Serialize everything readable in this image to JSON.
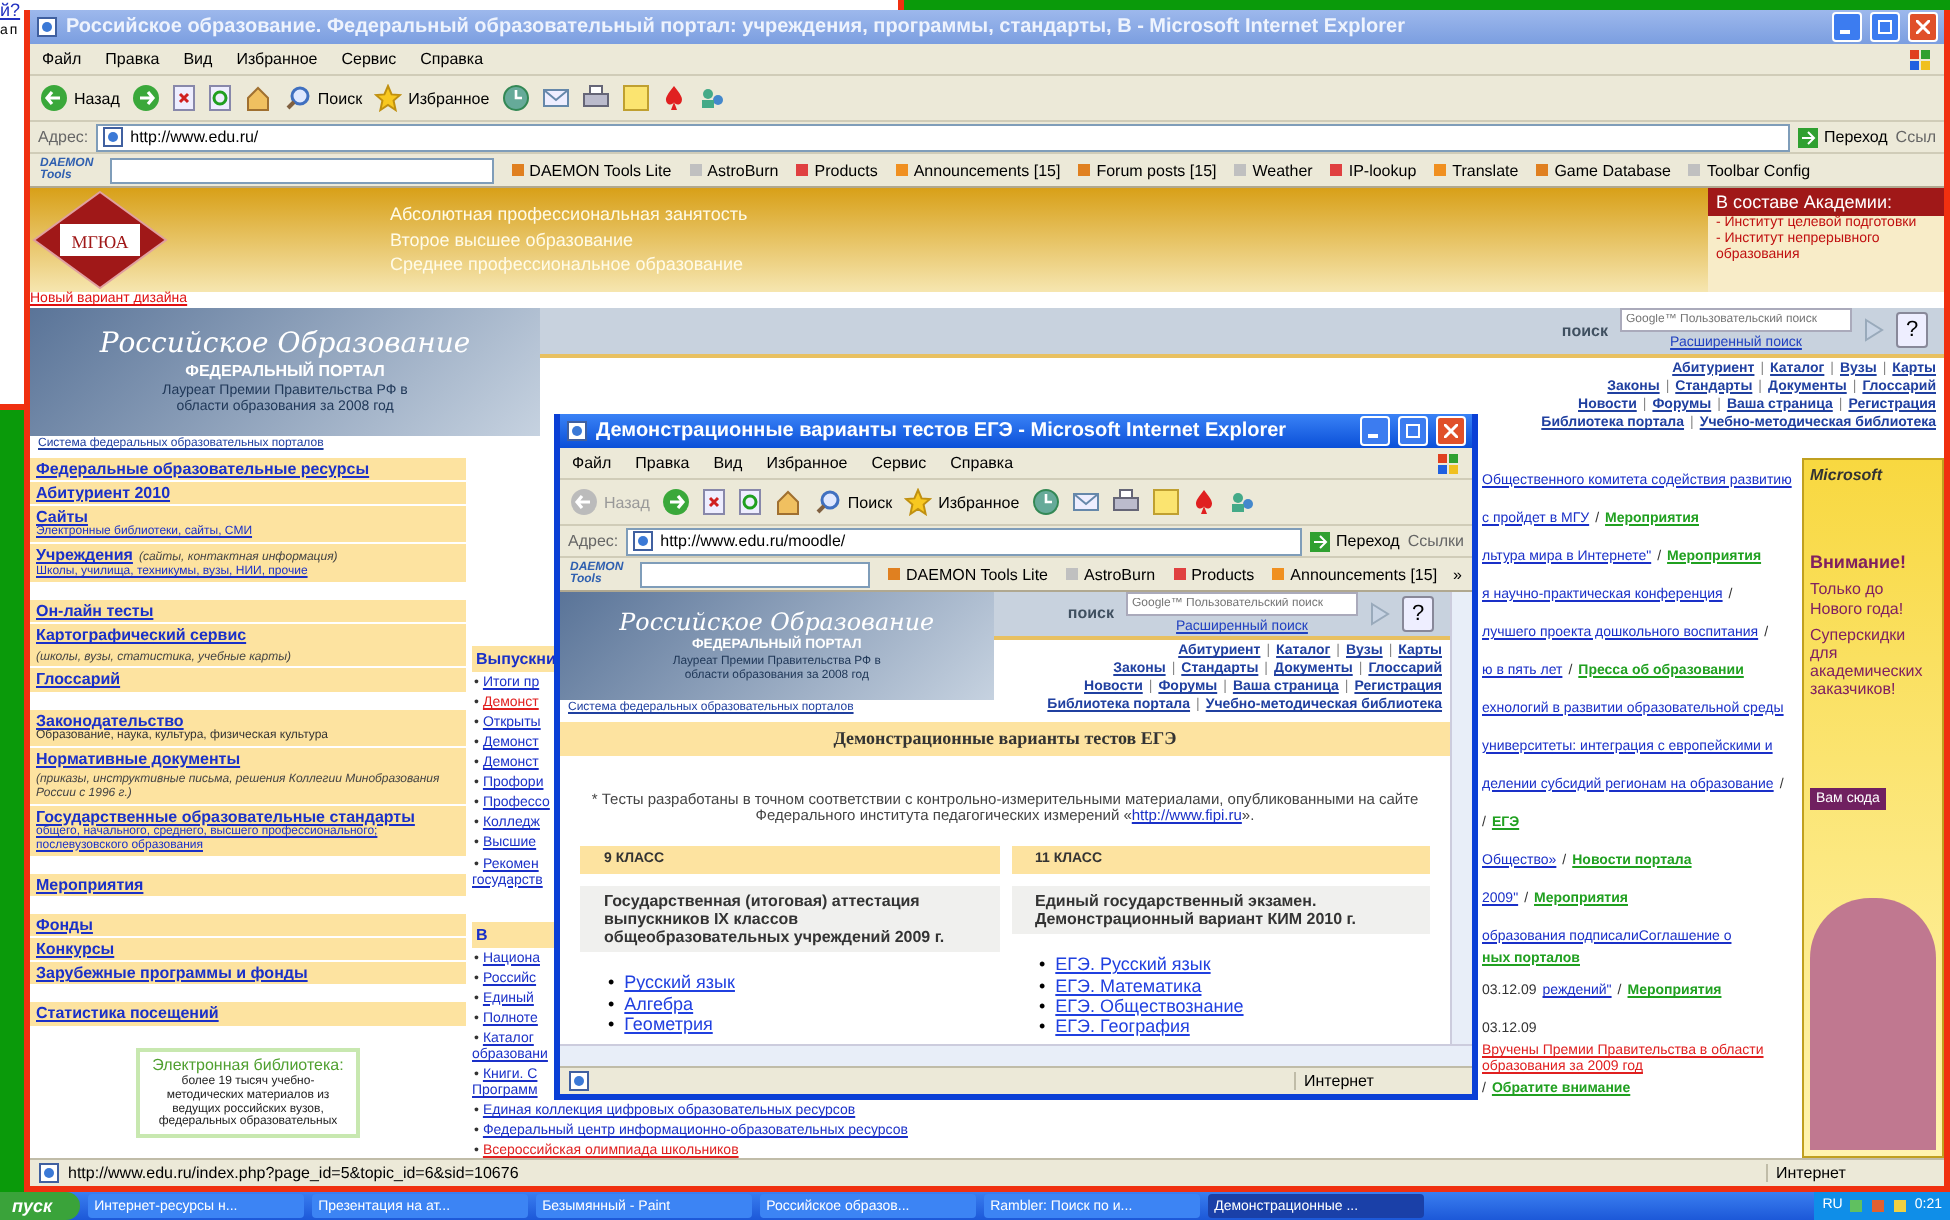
{
  "behind_window": {
    "link": "й?",
    "text": "а п"
  },
  "main_window": {
    "title": "Российское образование. Федеральный образовательный портал: учреждения, программы, стандарты, В - Microsoft Internet Explorer",
    "menu": [
      "Файл",
      "Правка",
      "Вид",
      "Избранное",
      "Сервис",
      "Справка"
    ],
    "toolbar": {
      "back": "Назад",
      "back_disabled": false,
      "search": "Поиск",
      "favorites": "Избранное"
    },
    "address": {
      "label": "Адрес:",
      "value": "http://www.edu.ru/",
      "go": "Переход",
      "links": "Ссыл"
    },
    "daemon": {
      "logo_top": "DAEMON",
      "logo_bottom": "Tools",
      "items": [
        "DAEMON Tools Lite",
        "AstroBurn",
        "Products",
        "Announcements [15]",
        "Forum posts [15]",
        "Weather",
        "IP-lookup",
        "Translate",
        "Game Database",
        "Toolbar Config"
      ]
    },
    "banner": {
      "logo": "МГЮА",
      "lines": [
        "Абсолютная профессиональная занятость",
        "Второе высшее образование",
        "Среднее профессиональное образование"
      ],
      "academy_title": "В составе Академии:",
      "academy_items": [
        "- Институт целевой подготовки",
        "- Институт непрерывного",
        "образования"
      ]
    },
    "new_design": "Новый вариант дизайна",
    "portal": {
      "logo": "Российское Образование",
      "subtitle": "ФЕДЕРАЛЬНЫЙ ПОРТАЛ",
      "laureate": "Лауреат Премии Правительства РФ в области образования за 2008 год",
      "search_label": "поиск",
      "search_placeholder": "Google™ Пользовательский поиск",
      "advanced": "Расширенный поиск",
      "help": "?",
      "nav": [
        [
          {
            "label": "Абитуриент"
          },
          {
            "sep": "|",
            "label": "Каталог"
          },
          {
            "sep": "|",
            "label": "Вузы"
          },
          {
            "sep": "|",
            "label": "Карты"
          }
        ],
        [
          {
            "label": "Законы"
          },
          {
            "sep": "|",
            "label": "Стандарты"
          },
          {
            "sep": "|",
            "label": "Документы"
          },
          {
            "sep": "|",
            "label": "Глоссарий"
          }
        ],
        [
          {
            "label": "Новости"
          },
          {
            "sep": "|",
            "label": "Форумы"
          },
          {
            "sep": "|",
            "label": "Ваша страница"
          },
          {
            "sep": "|",
            "label": "Регистрация"
          }
        ],
        [
          {
            "label": "Библиотека портала"
          },
          {
            "sep": "|",
            "label": "Учебно-методическая библиотека"
          }
        ]
      ],
      "system_link": "Система федеральных образовательных порталов"
    },
    "left_menu": [
      [
        {
          "title": "Федеральные образовательные ресурсы"
        },
        {
          "title": "Абитуриент 2010"
        },
        {
          "title": "Сайты",
          "sub": "Электронные библиотеки, сайты, СМИ"
        },
        {
          "title": "Учреждения",
          "note": "(сайты, контактная информация)",
          "sub": "Школы, училища, техникумы, вузы, НИИ, прочие"
        }
      ],
      [
        {
          "title": "Он-лайн тесты"
        },
        {
          "title": "Картографический сервис",
          "note": "(школы, вузы, статистика, учебные карты)"
        },
        {
          "title": "Глоссарий"
        }
      ],
      [
        {
          "title": "Законодательство",
          "desc": "Образование, наука, культура, физическая культура"
        },
        {
          "title": "Нормативные документы",
          "note": "(приказы, инструктивные письма, решения Коллегии Минобразования России с 1996 г.)"
        },
        {
          "title": "Государственные образовательные стандарты",
          "sub": "общего, начального, среднего, высшего профессионального; послевузовского образования"
        }
      ],
      [
        {
          "title": "Мероприятия"
        }
      ],
      [
        {
          "title": "Фонды"
        },
        {
          "title": "Конкурсы"
        },
        {
          "title": "Зарубежные программы и фонды"
        }
      ],
      [
        {
          "title": "Статистика посещений"
        }
      ]
    ],
    "library": {
      "title": "Электронная библиотека:",
      "text": "более 19 тысяч учебно-методических материалов из ведущих российских вузов, федеральных образовательных"
    },
    "middle": [
      {
        "title": "Выпускни",
        "items": [
          {
            "bullet": "•",
            "text": "Итоги пр",
            "hot": false
          },
          {
            "bullet": "•",
            "text": "Демонст",
            "hot": true
          },
          {
            "bullet": "•",
            "text": "Открыты",
            "hot": false
          },
          {
            "bullet": "•",
            "text": "Демонст",
            "hot": false
          },
          {
            "bullet": "•",
            "text": "Демонст",
            "hot": false
          },
          {
            "bullet": "•",
            "text": "Профори",
            "hot": false
          },
          {
            "bullet": "•",
            "text": "Профессо",
            "hot": false
          },
          {
            "bullet": "•",
            "text": "Колледж",
            "hot": false
          },
          {
            "bullet": "•",
            "text": "Высшие",
            "hot": false
          },
          {
            "bullet": "•",
            "text": "Рекомен",
            "hot": false,
            "cont": "государств"
          }
        ]
      },
      {
        "title": "В",
        "items": [
          {
            "bullet": "•",
            "text": "Национа",
            "hot": false
          },
          {
            "bullet": "•",
            "text": "Российс",
            "hot": false
          },
          {
            "bullet": "•",
            "text": "Единый",
            "hot": false
          },
          {
            "bullet": "•",
            "text": "Полноте",
            "hot": false
          },
          {
            "bullet": "•",
            "text": "Каталог",
            "hot": false,
            "cont": "образовани"
          },
          {
            "bullet": "•",
            "text": "Книги. С",
            "hot": false,
            "cont": "Программ"
          },
          {
            "bullet": "•",
            "text": "Единая коллекция цифровых образовательных ресурсов",
            "hot": false
          },
          {
            "bullet": "•",
            "text": "Федеральный центр информационно-образовательных ресурсов",
            "hot": false
          },
          {
            "bullet": "•",
            "text": "Всероссийская олимпиада школьников",
            "hot": true
          }
        ]
      }
    ],
    "news": [
      {
        "link": "Общественного комитета содействия развитию",
        "hot": false
      },
      {
        "link": "с пройдет в МГУ",
        "sep": "/",
        "category": "Мероприятия",
        "hot": false
      },
      {
        "link": "льтура мира в Интернете\"",
        "sep": "/",
        "category": "Мероприятия",
        "hot": false
      },
      {
        "link": "я научно-практическая конференция",
        "sep": "/",
        "hot": false
      },
      {
        "link": "лучшего проекта дошкольного воспитания",
        "sep": "/",
        "hot": false
      },
      {
        "link": "ю в пять лет",
        "sep": "/",
        "category": "Пресса об образовании",
        "hot": false
      },
      {
        "link": "ехнологий в развитии образовательной среды",
        "hot": false
      },
      {
        "link": "университеты: интеграция с европейскими и",
        "hot": false
      },
      {
        "link": "делении субсидий регионам на образование",
        "sep": "/",
        "hot": false
      },
      {
        "sep": "/",
        "category": "ЕГЭ"
      },
      {
        "link": "Общество»",
        "sep": "/",
        "category": "Новости портала",
        "hot": false
      },
      {
        "link": "2009\"",
        "sep": "/",
        "category": "Мероприятия",
        "hot": false
      },
      {
        "link": "образования подписалиСоглашение о",
        "category": "ных порталов",
        "hot": false
      },
      {
        "date": "03.12.09",
        "link": "реждений\"",
        "sep": "/",
        "category": "Мероприятия",
        "hot": false
      },
      {
        "date": "03.12.09",
        "link": "Вручены Премии Правительства в области образования за 2009 год",
        "sep": "/",
        "category": "Обратите внимание",
        "hot": true
      }
    ],
    "ad": {
      "brand": "Microsoft",
      "headline": "Внимание!",
      "line1": "Только до Нового года!",
      "line2": "Суперскидки для академических заказчиков!",
      "button": "Вам сюда"
    },
    "status": {
      "url": "http://www.edu.ru/index.php?page_id=5&topic_id=6&sid=10676",
      "zone": "Интернет"
    }
  },
  "popup_window": {
    "title": "Демонстрационные варианты тестов ЕГЭ - Microsoft Internet Explorer",
    "menu": [
      "Файл",
      "Правка",
      "Вид",
      "Избранное",
      "Сервис",
      "Справка"
    ],
    "toolbar": {
      "back": "Назад",
      "back_disabled": true,
      "search": "Поиск",
      "favorites": "Избранное"
    },
    "address": {
      "label": "Адрес:",
      "value": "http://www.edu.ru/moodle/",
      "go": "Переход",
      "links": "Ссылки"
    },
    "daemon": {
      "logo_top": "DAEMON",
      "logo_bottom": "Tools",
      "items": [
        "DAEMON Tools Lite",
        "AstroBurn",
        "Products",
        "Announcements [15]"
      ],
      "more": "»"
    },
    "portal": {
      "logo": "Российское Образование",
      "subtitle": "ФЕДЕРАЛЬНЫЙ ПОРТАЛ",
      "laureate": "Лауреат Премии Правительства РФ в области образования за 2008 год",
      "search_label": "поиск",
      "search_placeholder": "Google™ Пользовательский поиск",
      "advanced": "Расширенный поиск",
      "help": "?",
      "nav": [
        [
          {
            "label": "Абитуриент"
          },
          {
            "sep": "|",
            "label": "Каталог"
          },
          {
            "sep": "|",
            "label": "Вузы"
          },
          {
            "sep": "|",
            "label": "Карты"
          }
        ],
        [
          {
            "label": "Законы"
          },
          {
            "sep": "|",
            "label": "Стандарты"
          },
          {
            "sep": "|",
            "label": "Документы"
          },
          {
            "sep": "|",
            "label": "Глоссарий"
          }
        ],
        [
          {
            "label": "Новости"
          },
          {
            "sep": "|",
            "label": "Форумы"
          },
          {
            "sep": "|",
            "label": "Ваша страница"
          },
          {
            "sep": "|",
            "label": "Регистрация"
          }
        ],
        [
          {
            "label": "Библиотека портала"
          },
          {
            "sep": "|",
            "label": "Учебно-методическая библиотека"
          }
        ]
      ],
      "system_link": "Система федеральных образовательных порталов"
    },
    "section_title": "Демонстрационные варианты тестов ЕГЭ",
    "note": "* Тесты разработаны в точном соответствии с контрольно-измерительными материалами, опубликованными на сайте Федерального института педагогических измерений «",
    "note_link": "http://www.fipi.ru",
    "note_end": "».",
    "columns": [
      {
        "grade": "9 КЛАСС",
        "heading": "Государственная (итоговая) аттестация выпускников IX классов общеобразовательных учреждений 2009 г.",
        "links": [
          {
            "bullet": "•",
            "label": "Русский язык"
          },
          {
            "bullet": "•",
            "label": "Алгебра"
          },
          {
            "bullet": "•",
            "label": "Геометрия"
          }
        ]
      },
      {
        "grade": "11 КЛАСС",
        "heading": "Единый государственный экзамен. Демонстрационный вариант КИМ 2010 г.",
        "links": [
          {
            "bullet": "•",
            "label": "ЕГЭ. Русский язык"
          },
          {
            "bullet": "•",
            "label": "ЕГЭ. Математика"
          },
          {
            "bullet": "•",
            "label": "ЕГЭ. Обществознание"
          },
          {
            "bullet": "•",
            "label": "ЕГЭ. География"
          }
        ]
      }
    ],
    "status": {
      "zone": "Интернет"
    }
  },
  "taskbar": {
    "start": "пуск",
    "tasks": [
      {
        "label": "Интернет-ресурсы н...",
        "selected": false
      },
      {
        "label": "Презентация на ат...",
        "selected": false
      },
      {
        "label": "Безымянный - Paint",
        "selected": false
      },
      {
        "label": "Российское образов...",
        "selected": false
      },
      {
        "label": "Rambler: Поиск по и...",
        "selected": false
      },
      {
        "label": "Демонстрационные ...",
        "selected": true
      }
    ],
    "lang": "RU",
    "clock": "0:21"
  }
}
